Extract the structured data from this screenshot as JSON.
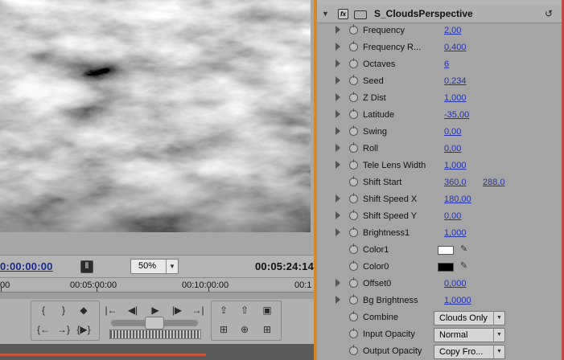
{
  "monitor": {
    "current_time": "0:00:00:00",
    "duration": "00:05:24:14",
    "zoom_level": "50%",
    "zoom_arrow": "▼",
    "safe_margin_icon": "safe-margins-icon",
    "ruler_labels": [
      "00",
      "00:05:00:00",
      "00:10:00:00",
      "00:1"
    ],
    "transport": {
      "set_in_icon": "{",
      "set_out_icon": "}",
      "add_marker_icon": "◆",
      "go_to_in_icon": "{←",
      "go_to_out_icon": "→}",
      "play_in_to_out_icon": "{▶}",
      "step_back_to_edit_icon": "|←",
      "step_back_icon": "◀|",
      "play_icon": "▶",
      "step_forward_icon": "|▶",
      "step_forward_to_edit_icon": "→|",
      "lift_icon": "⇪",
      "extract_icon": "⇧",
      "export_frame_icon": "▣",
      "trim_monitor_icon": "⊞",
      "overwrite_icon": "⊕",
      "insert_icon": "⊞"
    }
  },
  "effect": {
    "title": "S_CloudsPerspective",
    "fx_badge": "fx",
    "reset_icon": "↺",
    "params": [
      {
        "name": "Frequency",
        "v1": "2,00",
        "twirl": true
      },
      {
        "name": "Frequency R...",
        "v1": "0,400",
        "twirl": true
      },
      {
        "name": "Octaves",
        "v1": "6",
        "twirl": true
      },
      {
        "name": "Seed",
        "v1": "0,234",
        "twirl": true
      },
      {
        "name": "Z Dist",
        "v1": "1,000",
        "twirl": true
      },
      {
        "name": "Latitude",
        "v1": "-35,00",
        "twirl": true
      },
      {
        "name": "Swing",
        "v1": "0,00",
        "twirl": true
      },
      {
        "name": "Roll",
        "v1": "0,00",
        "twirl": true
      },
      {
        "name": "Tele Lens Width",
        "v1": "1,000",
        "twirl": true
      },
      {
        "name": "Shift Start",
        "v1": "360,0",
        "v2": "288,0",
        "twirl": false
      },
      {
        "name": "Shift Speed X",
        "v1": "180,00",
        "twirl": true
      },
      {
        "name": "Shift Speed Y",
        "v1": "0,00",
        "twirl": true
      },
      {
        "name": "Brightness1",
        "v1": "1,000",
        "twirl": true
      },
      {
        "name": "Color1",
        "color": "#ffffff",
        "twirl": false
      },
      {
        "name": "Color0",
        "color": "#000000",
        "twirl": false
      },
      {
        "name": "Offset0",
        "v1": "0,000",
        "twirl": true
      },
      {
        "name": "Bg Brightness",
        "v1": "1,0000",
        "twirl": true
      },
      {
        "name": "Combine",
        "dropdown": "Clouds Only",
        "twirl": false
      },
      {
        "name": "Input Opacity",
        "dropdown": "Normal",
        "twirl": false
      },
      {
        "name": "Output Opacity",
        "dropdown": "Copy Fro...",
        "twirl": false
      }
    ],
    "dropdown_arrow": "▼",
    "eyedropper_icon": "✎"
  },
  "colors": {
    "panel_accent": "#cf8a2c",
    "timecode_blue": "#1a2a8c",
    "value_blue": "#2233aa"
  }
}
